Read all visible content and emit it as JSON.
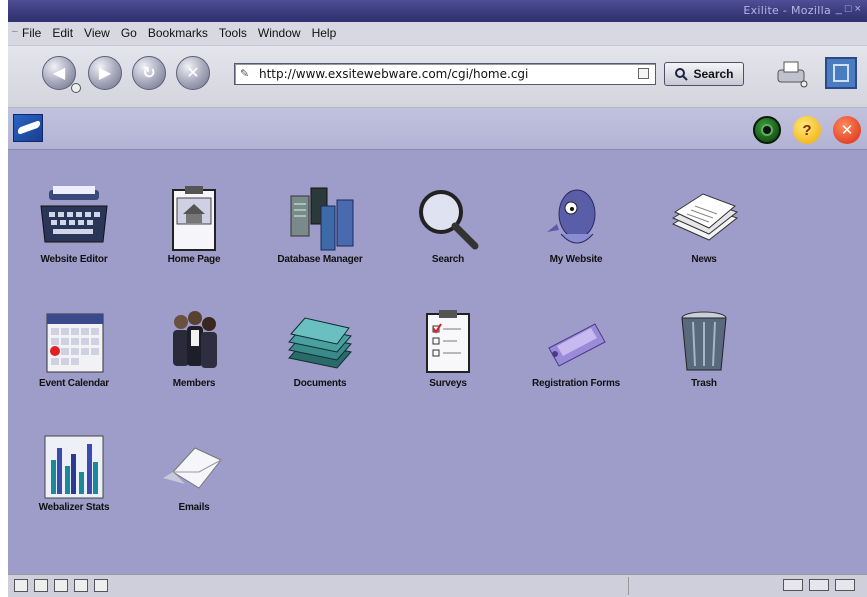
{
  "window": {
    "title": "Exilite - Mozilla",
    "controls": "_ □ ×"
  },
  "menu": [
    "File",
    "Edit",
    "View",
    "Go",
    "Bookmarks",
    "Tools",
    "Window",
    "Help"
  ],
  "nav": {
    "url": "http://www.exsitewebware.com/cgi/home.cgi",
    "search_label": "Search"
  },
  "app": {
    "help_symbol": "?",
    "close_symbol": "✕"
  },
  "tiles": [
    {
      "label": "Website Editor",
      "icon": "typewriter-icon"
    },
    {
      "label": "Home Page",
      "icon": "clipboard-house-icon"
    },
    {
      "label": "Database Manager",
      "icon": "server-stack-icon"
    },
    {
      "label": "Search",
      "icon": "magnifier-icon"
    },
    {
      "label": "My Website",
      "icon": "globe-fish-icon"
    },
    {
      "label": "News",
      "icon": "newspaper-icon"
    },
    {
      "label": "Event Calendar",
      "icon": "calendar-icon"
    },
    {
      "label": "Members",
      "icon": "people-icon"
    },
    {
      "label": "Documents",
      "icon": "document-stack-icon"
    },
    {
      "label": "Surveys",
      "icon": "survey-clipboard-icon"
    },
    {
      "label": "Registration Forms",
      "icon": "ticket-icon"
    },
    {
      "label": "Trash",
      "icon": "trash-can-icon"
    },
    {
      "label": "Webalizer Stats",
      "icon": "bar-chart-icon"
    },
    {
      "label": "Emails",
      "icon": "envelope-icon"
    }
  ]
}
